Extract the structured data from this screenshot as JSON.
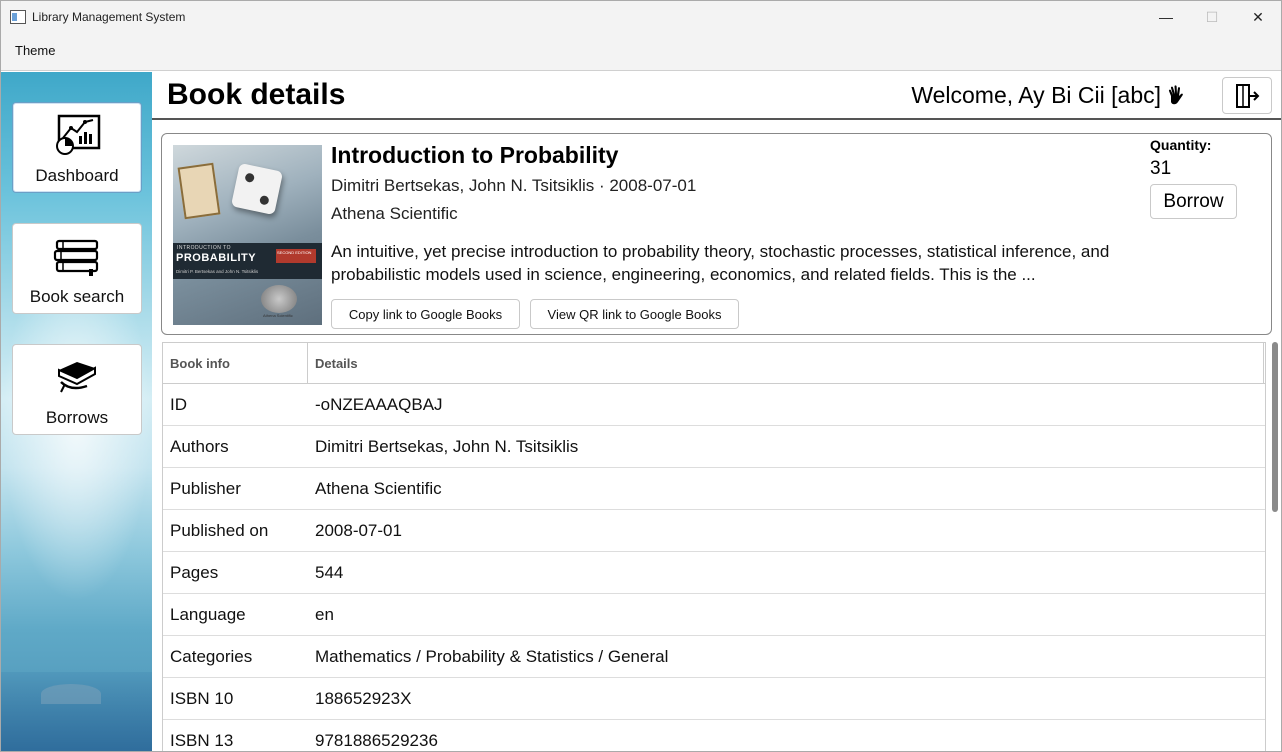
{
  "window": {
    "title": "Library Management System",
    "controls": {
      "minimize": "—",
      "maximize": "☐",
      "close": "✕"
    }
  },
  "menu": {
    "theme": "Theme"
  },
  "sidebar": {
    "items": [
      {
        "label": "Dashboard",
        "icon": "dashboard-chart-icon",
        "active": true
      },
      {
        "label": "Book search",
        "icon": "books-stack-icon",
        "active": false
      },
      {
        "label": "Borrows",
        "icon": "hand-book-icon",
        "active": false
      }
    ]
  },
  "header": {
    "title": "Book details",
    "welcome": "Welcome, Ay Bi Cii [abc]",
    "wave_icon": "waving-hand-icon",
    "logout_icon": "logout-icon"
  },
  "book": {
    "title": "Introduction to Probability",
    "byline": "Dimitri Bertsekas, John N. Tsitsiklis · 2008-07-01",
    "publisher": "Athena Scientific",
    "description": " An intuitive, yet precise introduction to probability theory, stochastic processes, statistical inference, and probabilistic models used in science, engineering, economics, and related fields. This is the ...",
    "copy_link_label": "Copy link to Google Books",
    "qr_link_label": "View QR link to Google Books",
    "quantity_label": "Quantity:",
    "quantity_value": "31",
    "borrow_label": "Borrow",
    "cover": {
      "top_line": "INTRODUCTION TO",
      "title": "PROBABILITY",
      "authors": "Dimitri P. Bertsekas and John N. Tsitsiklis",
      "edition": "SECOND EDITION",
      "publisher": "Athena Scientific"
    }
  },
  "table": {
    "headers": [
      "Book info",
      "Details"
    ],
    "rows": [
      {
        "key": "ID",
        "value": "-oNZEAAAQBAJ"
      },
      {
        "key": "Authors",
        "value": "Dimitri Bertsekas, John N. Tsitsiklis"
      },
      {
        "key": "Publisher",
        "value": "Athena Scientific"
      },
      {
        "key": "Published on",
        "value": "2008-07-01"
      },
      {
        "key": "Pages",
        "value": "544"
      },
      {
        "key": "Language",
        "value": "en"
      },
      {
        "key": "Categories",
        "value": "Mathematics / Probability & Statistics / General"
      },
      {
        "key": "ISBN 10",
        "value": "188652923X"
      },
      {
        "key": "ISBN 13",
        "value": "9781886529236"
      }
    ]
  }
}
